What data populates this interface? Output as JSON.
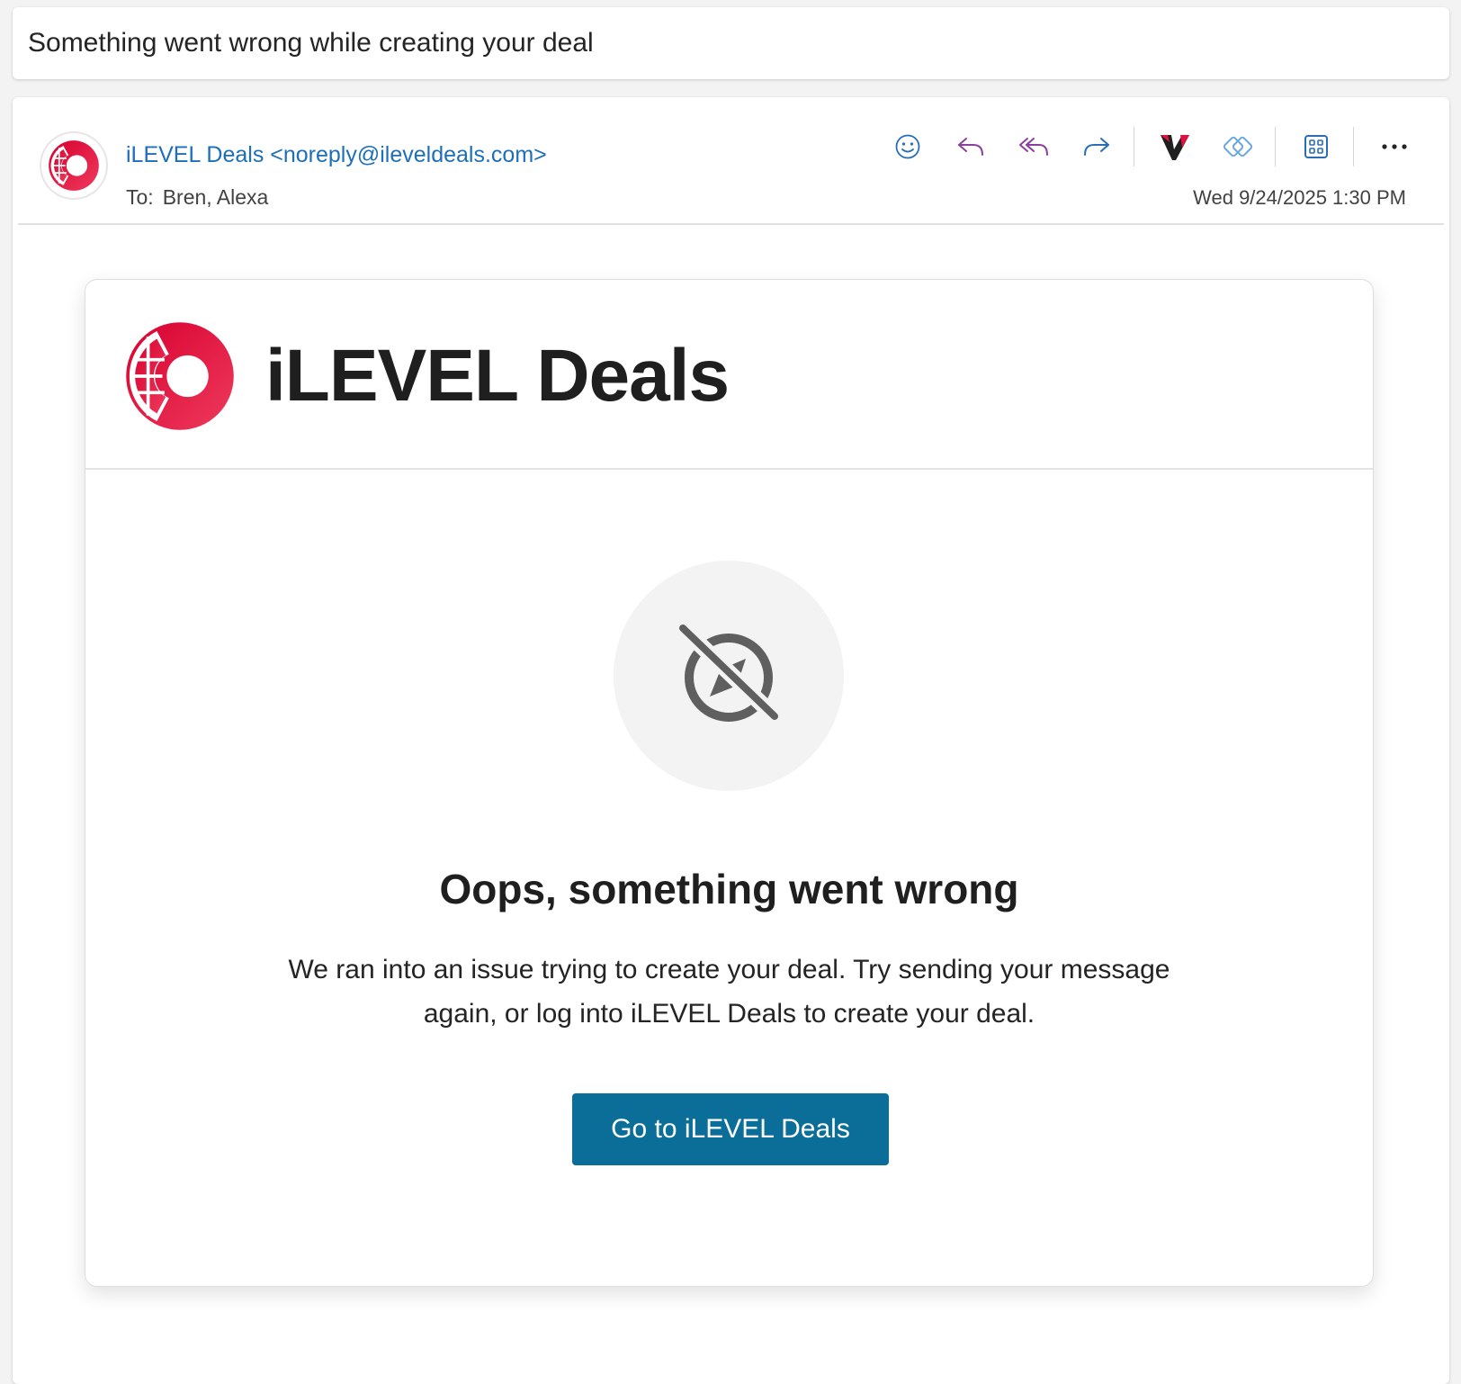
{
  "subject": "Something went wrong while creating your deal",
  "header": {
    "sender": "iLEVEL Deals <noreply@ileveldeals.com>",
    "to_label": "To:",
    "to_value": "Bren, Alexa",
    "date": "Wed 9/24/2025 1:30 PM"
  },
  "toolbar": {
    "icons": [
      "smiley-icon",
      "reply-icon",
      "reply-all-icon",
      "forward-icon",
      "v-addin-icon",
      "loop-icon",
      "apps-icon",
      "more-icon"
    ],
    "more_label": "···"
  },
  "email": {
    "brand_name": "iLEVEL Deals",
    "headline": "Oops, something went wrong",
    "body": "We ran into an issue trying to create your deal. Try sending your message again, or log into iLEVEL Deals to create your deal.",
    "cta_label": "Go to iLEVEL Deals"
  },
  "colors": {
    "brand_red": "#e0103f",
    "link_blue": "#1c6fb8",
    "cta_blue": "#0b6e99",
    "reply_purple": "#8a3fa0"
  }
}
